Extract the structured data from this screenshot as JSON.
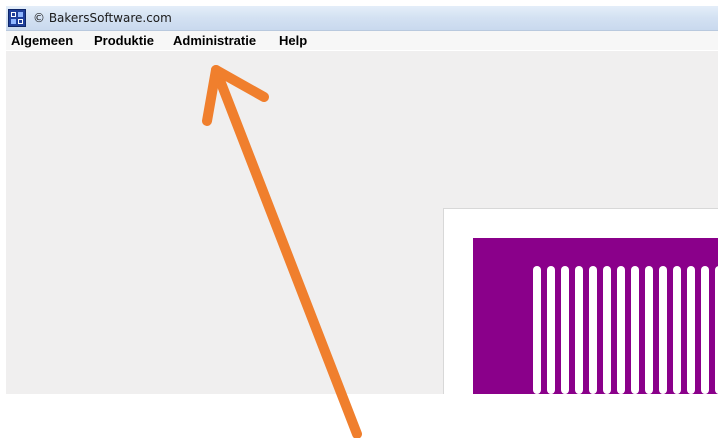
{
  "window": {
    "title": "© BakersSoftware.com",
    "icon": "app-icon"
  },
  "menubar": {
    "items": [
      {
        "label": "Algemeen"
      },
      {
        "label": "Produktie"
      },
      {
        "label": "Administratie"
      },
      {
        "label": "Help"
      }
    ]
  },
  "colors": {
    "workspace_bg": "#f0efef",
    "logo_purple": "#8a008a",
    "arrow_orange": "#f07f2d"
  },
  "annotation": {
    "type": "arrow",
    "target": "menu-item-administratie"
  }
}
